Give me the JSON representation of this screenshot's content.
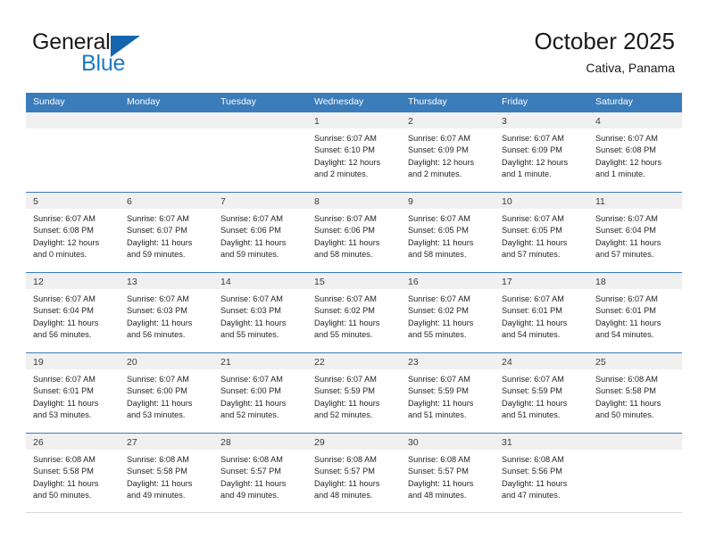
{
  "brand": {
    "name_top": "General",
    "name_bottom": "Blue",
    "triangle_color": "#1565ae",
    "blue_text_color": "#1f7ac0"
  },
  "header": {
    "title": "October 2025",
    "subtitle": "Cativa, Panama"
  },
  "theme": {
    "header_blue": "#3b7cba",
    "day_band_gray": "#f0f0f0",
    "text_color": "#262626"
  },
  "weekdays": [
    "Sunday",
    "Monday",
    "Tuesday",
    "Wednesday",
    "Thursday",
    "Friday",
    "Saturday"
  ],
  "weeks": [
    [
      {
        "day": "",
        "empty": true,
        "lines": []
      },
      {
        "day": "",
        "empty": true,
        "lines": []
      },
      {
        "day": "",
        "empty": true,
        "lines": []
      },
      {
        "day": "1",
        "empty": false,
        "lines": [
          "Sunrise: 6:07 AM",
          "Sunset: 6:10 PM",
          "Daylight: 12 hours",
          "and 2 minutes."
        ]
      },
      {
        "day": "2",
        "empty": false,
        "lines": [
          "Sunrise: 6:07 AM",
          "Sunset: 6:09 PM",
          "Daylight: 12 hours",
          "and 2 minutes."
        ]
      },
      {
        "day": "3",
        "empty": false,
        "lines": [
          "Sunrise: 6:07 AM",
          "Sunset: 6:09 PM",
          "Daylight: 12 hours",
          "and 1 minute."
        ]
      },
      {
        "day": "4",
        "empty": false,
        "lines": [
          "Sunrise: 6:07 AM",
          "Sunset: 6:08 PM",
          "Daylight: 12 hours",
          "and 1 minute."
        ]
      }
    ],
    [
      {
        "day": "5",
        "empty": false,
        "lines": [
          "Sunrise: 6:07 AM",
          "Sunset: 6:08 PM",
          "Daylight: 12 hours",
          "and 0 minutes."
        ]
      },
      {
        "day": "6",
        "empty": false,
        "lines": [
          "Sunrise: 6:07 AM",
          "Sunset: 6:07 PM",
          "Daylight: 11 hours",
          "and 59 minutes."
        ]
      },
      {
        "day": "7",
        "empty": false,
        "lines": [
          "Sunrise: 6:07 AM",
          "Sunset: 6:06 PM",
          "Daylight: 11 hours",
          "and 59 minutes."
        ]
      },
      {
        "day": "8",
        "empty": false,
        "lines": [
          "Sunrise: 6:07 AM",
          "Sunset: 6:06 PM",
          "Daylight: 11 hours",
          "and 58 minutes."
        ]
      },
      {
        "day": "9",
        "empty": false,
        "lines": [
          "Sunrise: 6:07 AM",
          "Sunset: 6:05 PM",
          "Daylight: 11 hours",
          "and 58 minutes."
        ]
      },
      {
        "day": "10",
        "empty": false,
        "lines": [
          "Sunrise: 6:07 AM",
          "Sunset: 6:05 PM",
          "Daylight: 11 hours",
          "and 57 minutes."
        ]
      },
      {
        "day": "11",
        "empty": false,
        "lines": [
          "Sunrise: 6:07 AM",
          "Sunset: 6:04 PM",
          "Daylight: 11 hours",
          "and 57 minutes."
        ]
      }
    ],
    [
      {
        "day": "12",
        "empty": false,
        "lines": [
          "Sunrise: 6:07 AM",
          "Sunset: 6:04 PM",
          "Daylight: 11 hours",
          "and 56 minutes."
        ]
      },
      {
        "day": "13",
        "empty": false,
        "lines": [
          "Sunrise: 6:07 AM",
          "Sunset: 6:03 PM",
          "Daylight: 11 hours",
          "and 56 minutes."
        ]
      },
      {
        "day": "14",
        "empty": false,
        "lines": [
          "Sunrise: 6:07 AM",
          "Sunset: 6:03 PM",
          "Daylight: 11 hours",
          "and 55 minutes."
        ]
      },
      {
        "day": "15",
        "empty": false,
        "lines": [
          "Sunrise: 6:07 AM",
          "Sunset: 6:02 PM",
          "Daylight: 11 hours",
          "and 55 minutes."
        ]
      },
      {
        "day": "16",
        "empty": false,
        "lines": [
          "Sunrise: 6:07 AM",
          "Sunset: 6:02 PM",
          "Daylight: 11 hours",
          "and 55 minutes."
        ]
      },
      {
        "day": "17",
        "empty": false,
        "lines": [
          "Sunrise: 6:07 AM",
          "Sunset: 6:01 PM",
          "Daylight: 11 hours",
          "and 54 minutes."
        ]
      },
      {
        "day": "18",
        "empty": false,
        "lines": [
          "Sunrise: 6:07 AM",
          "Sunset: 6:01 PM",
          "Daylight: 11 hours",
          "and 54 minutes."
        ]
      }
    ],
    [
      {
        "day": "19",
        "empty": false,
        "lines": [
          "Sunrise: 6:07 AM",
          "Sunset: 6:01 PM",
          "Daylight: 11 hours",
          "and 53 minutes."
        ]
      },
      {
        "day": "20",
        "empty": false,
        "lines": [
          "Sunrise: 6:07 AM",
          "Sunset: 6:00 PM",
          "Daylight: 11 hours",
          "and 53 minutes."
        ]
      },
      {
        "day": "21",
        "empty": false,
        "lines": [
          "Sunrise: 6:07 AM",
          "Sunset: 6:00 PM",
          "Daylight: 11 hours",
          "and 52 minutes."
        ]
      },
      {
        "day": "22",
        "empty": false,
        "lines": [
          "Sunrise: 6:07 AM",
          "Sunset: 5:59 PM",
          "Daylight: 11 hours",
          "and 52 minutes."
        ]
      },
      {
        "day": "23",
        "empty": false,
        "lines": [
          "Sunrise: 6:07 AM",
          "Sunset: 5:59 PM",
          "Daylight: 11 hours",
          "and 51 minutes."
        ]
      },
      {
        "day": "24",
        "empty": false,
        "lines": [
          "Sunrise: 6:07 AM",
          "Sunset: 5:59 PM",
          "Daylight: 11 hours",
          "and 51 minutes."
        ]
      },
      {
        "day": "25",
        "empty": false,
        "lines": [
          "Sunrise: 6:08 AM",
          "Sunset: 5:58 PM",
          "Daylight: 11 hours",
          "and 50 minutes."
        ]
      }
    ],
    [
      {
        "day": "26",
        "empty": false,
        "lines": [
          "Sunrise: 6:08 AM",
          "Sunset: 5:58 PM",
          "Daylight: 11 hours",
          "and 50 minutes."
        ]
      },
      {
        "day": "27",
        "empty": false,
        "lines": [
          "Sunrise: 6:08 AM",
          "Sunset: 5:58 PM",
          "Daylight: 11 hours",
          "and 49 minutes."
        ]
      },
      {
        "day": "28",
        "empty": false,
        "lines": [
          "Sunrise: 6:08 AM",
          "Sunset: 5:57 PM",
          "Daylight: 11 hours",
          "and 49 minutes."
        ]
      },
      {
        "day": "29",
        "empty": false,
        "lines": [
          "Sunrise: 6:08 AM",
          "Sunset: 5:57 PM",
          "Daylight: 11 hours",
          "and 48 minutes."
        ]
      },
      {
        "day": "30",
        "empty": false,
        "lines": [
          "Sunrise: 6:08 AM",
          "Sunset: 5:57 PM",
          "Daylight: 11 hours",
          "and 48 minutes."
        ]
      },
      {
        "day": "31",
        "empty": false,
        "lines": [
          "Sunrise: 6:08 AM",
          "Sunset: 5:56 PM",
          "Daylight: 11 hours",
          "and 47 minutes."
        ]
      },
      {
        "day": "",
        "empty": true,
        "lines": []
      }
    ]
  ]
}
